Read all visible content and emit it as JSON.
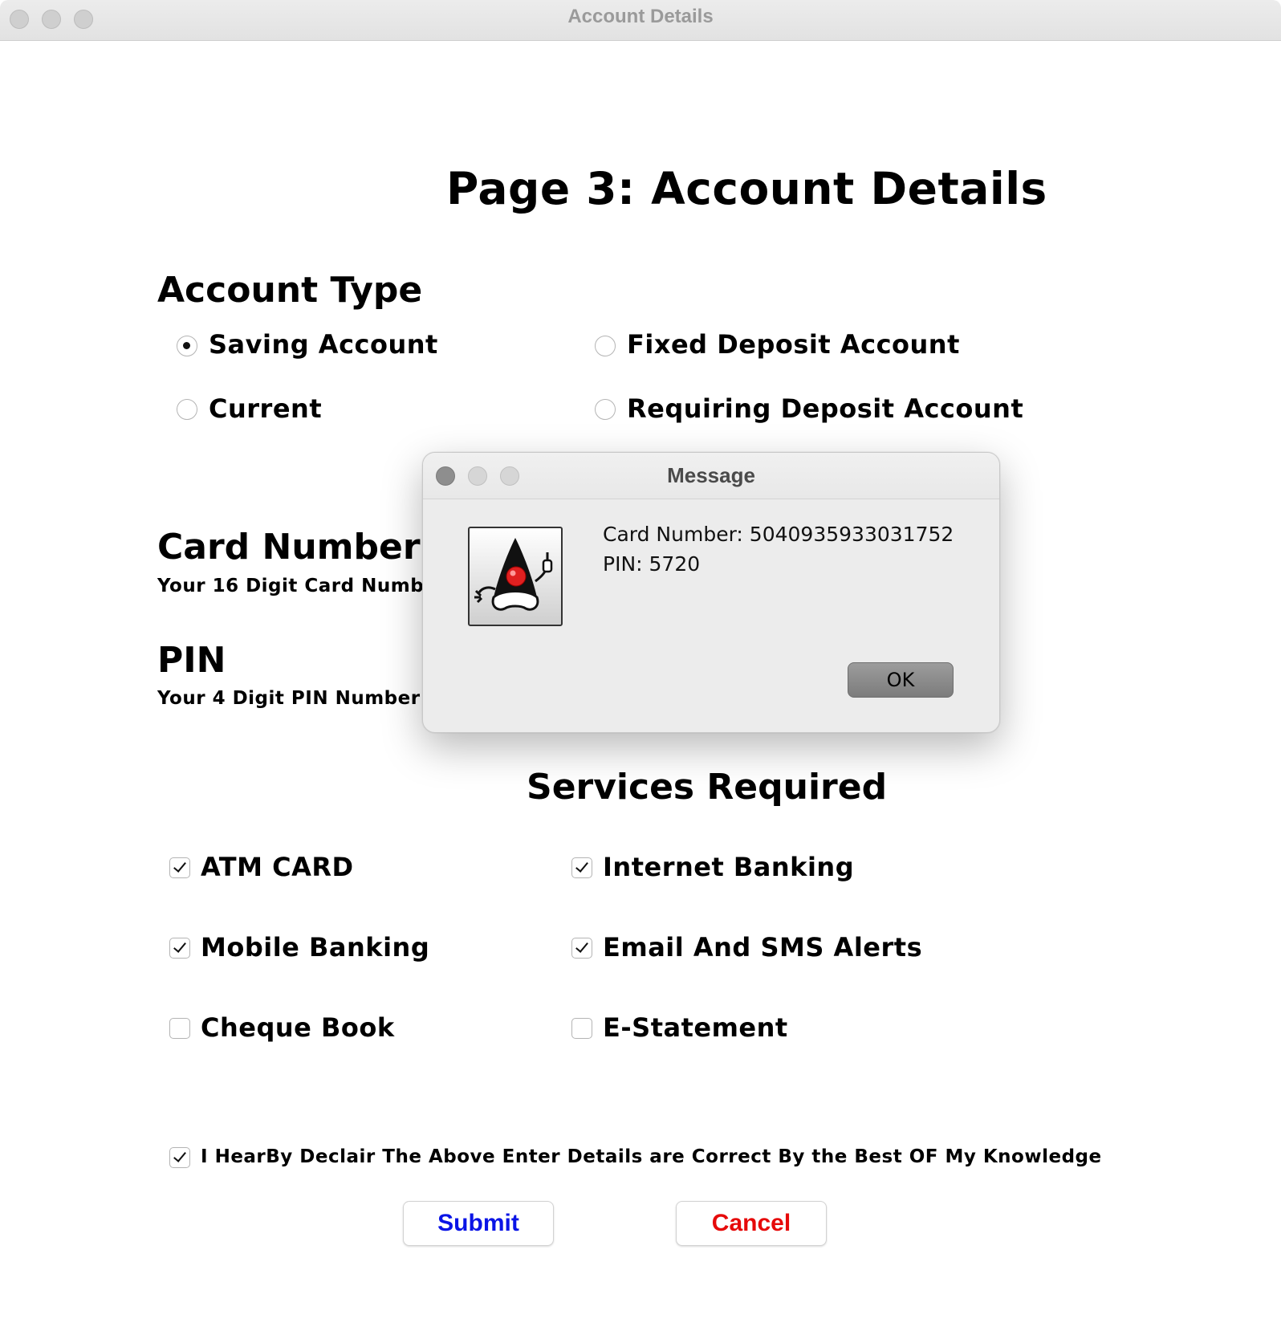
{
  "window": {
    "title": "Account Details"
  },
  "page": {
    "heading": "Page 3: Account Details",
    "account_type": {
      "heading": "Account Type",
      "options": [
        {
          "label": "Saving Account",
          "selected": true
        },
        {
          "label": "Fixed Deposit Account",
          "selected": false
        },
        {
          "label": "Current",
          "selected": false
        },
        {
          "label": "Requiring Deposit Account",
          "selected": false
        }
      ]
    },
    "card_number": {
      "heading": "Card Number",
      "subtext": "Your 16 Digit Card Numbe"
    },
    "pin": {
      "heading": "PIN",
      "subtext": "Your 4 Digit PIN Number"
    },
    "services": {
      "heading": "Services Required",
      "items": [
        {
          "label": "ATM CARD",
          "checked": true
        },
        {
          "label": "Internet Banking",
          "checked": true
        },
        {
          "label": "Mobile Banking",
          "checked": true
        },
        {
          "label": "Email And SMS Alerts",
          "checked": true
        },
        {
          "label": "Cheque Book",
          "checked": false
        },
        {
          "label": "E-Statement",
          "checked": false
        }
      ]
    },
    "declaration": {
      "label": "I HearBy Declair The Above Enter Details are Correct By the Best OF My Knowledge",
      "checked": true
    },
    "buttons": {
      "submit": "Submit",
      "cancel": "Cancel"
    }
  },
  "dialog": {
    "title": "Message",
    "icon": "java-duke-icon",
    "line1": "Card Number: 5040935933031752",
    "line2": "PIN: 5720",
    "ok": "OK"
  },
  "colors": {
    "submit": "#0a14e6",
    "cancel": "#e60a0a"
  }
}
